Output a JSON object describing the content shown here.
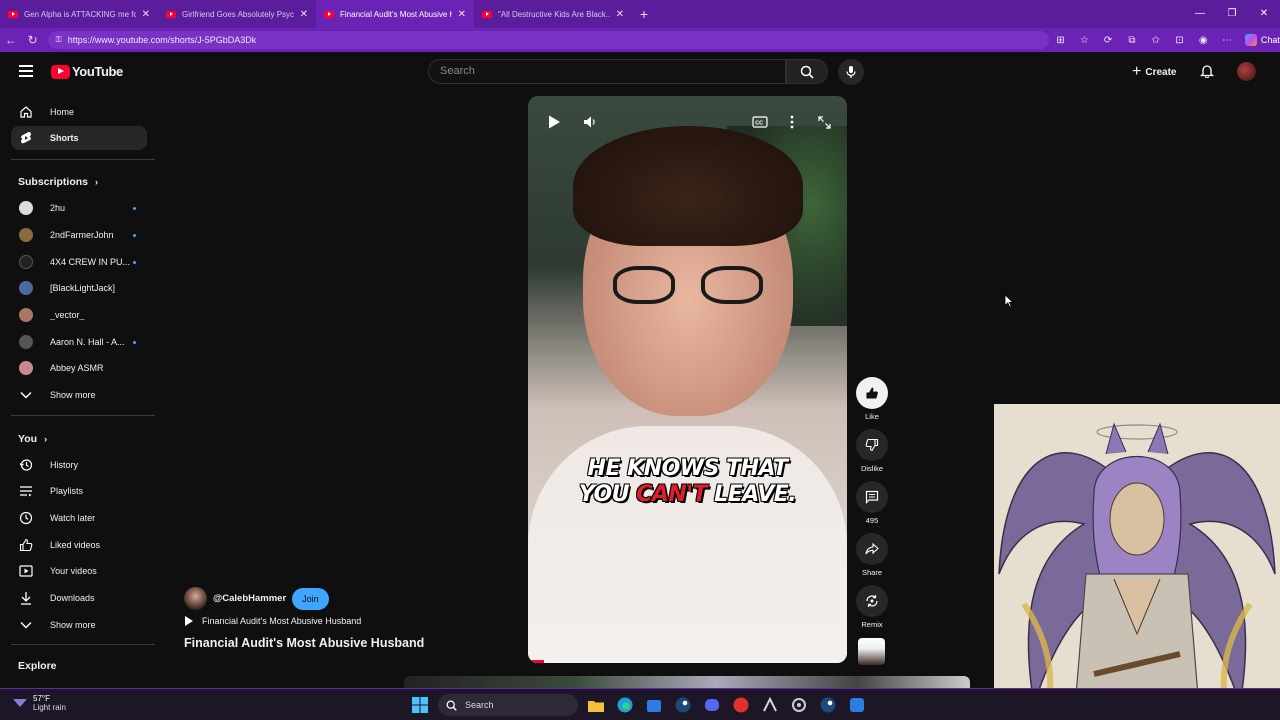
{
  "browser": {
    "tabs": [
      {
        "title": "Gen Alpha is ATTACKING me for s",
        "active": false
      },
      {
        "title": "Girlfriend Goes Absolutely Psycho",
        "active": false
      },
      {
        "title": "Financial Audit's Most Abusive Hu",
        "active": true
      },
      {
        "title": "\"All Destructive Kids Are Black...\" S",
        "active": false
      }
    ],
    "url": "https://www.youtube.com/shorts/J-5PGbDA3Dk",
    "chat_label": "Chat"
  },
  "youtube": {
    "logo_text": "YouTube",
    "search_placeholder": "Search",
    "create_label": "Create",
    "sidebar": {
      "primary": [
        {
          "label": "Home",
          "icon": "home-icon",
          "active": false
        },
        {
          "label": "Shorts",
          "icon": "shorts-icon",
          "active": true
        }
      ],
      "subscriptions_heading": "Subscriptions",
      "subscriptions": [
        {
          "label": "2hu",
          "color": "#dddddd",
          "new": true
        },
        {
          "label": "2ndFarmerJohn",
          "color": "#8a6a3a",
          "new": true
        },
        {
          "label": "4X4 CREW IN PU...",
          "color": "#222222",
          "new": true
        },
        {
          "label": "[BlackLightJack]",
          "color": "#4a6aa0",
          "new": false
        },
        {
          "label": "_vector_",
          "color": "#aa7766",
          "new": false
        },
        {
          "label": "Aaron N. Hall - A...",
          "color": "#555555",
          "new": true
        },
        {
          "label": "Abbey ASMR",
          "color": "#cc8888",
          "new": false
        }
      ],
      "show_more_1": "Show more",
      "you_heading": "You",
      "you_items": [
        {
          "label": "History",
          "icon": "history-icon"
        },
        {
          "label": "Playlists",
          "icon": "playlists-icon"
        },
        {
          "label": "Watch later",
          "icon": "watch-later-icon"
        },
        {
          "label": "Liked videos",
          "icon": "liked-videos-icon"
        },
        {
          "label": "Your videos",
          "icon": "your-videos-icon"
        },
        {
          "label": "Downloads",
          "icon": "downloads-icon"
        }
      ],
      "show_more_2": "Show more",
      "explore_heading": "Explore"
    },
    "short": {
      "caption_part1": "HE KNOWS THAT",
      "caption_part2a": "YOU ",
      "caption_red": "CAN'T",
      "caption_part2b": " LEAVE.",
      "progress_fraction": 0.05,
      "channel_handle": "@CalebHammer",
      "join_label": "Join",
      "sound_title": "Financial Audit's Most Abusive Husband",
      "title": "Financial Audit's Most Abusive Husband"
    },
    "actions": {
      "like": "Like",
      "dislike": "Dislike",
      "comments": "495",
      "share": "Share",
      "remix": "Remix"
    }
  },
  "taskbar": {
    "temperature": "57°F",
    "condition": "Light rain",
    "search_label": "Search"
  }
}
